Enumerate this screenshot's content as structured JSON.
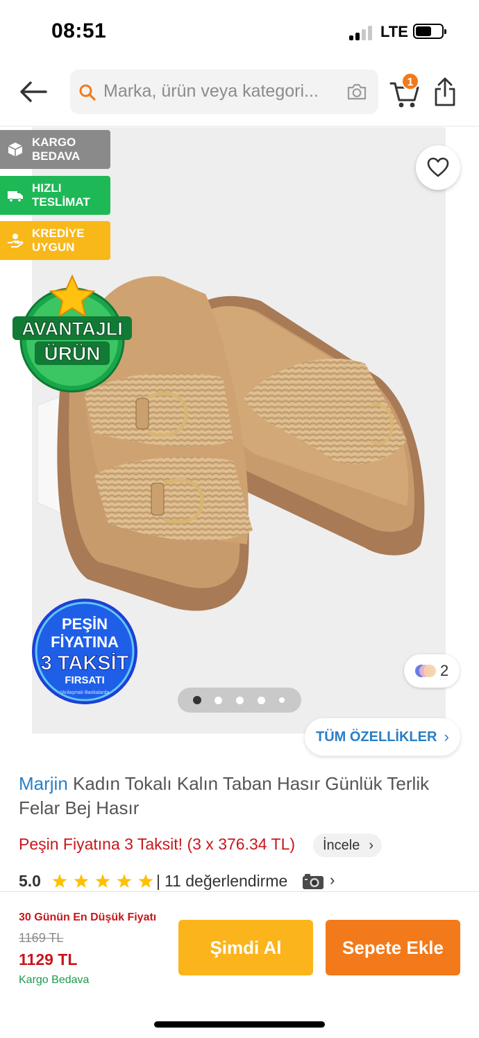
{
  "status": {
    "time": "08:51",
    "network": "LTE",
    "battery_level": 0.6
  },
  "header": {
    "search_placeholder": "Marka, ürün veya kategori...",
    "cart_count": "1"
  },
  "badges": [
    {
      "line1": "KARGO",
      "line2": "BEDAVA",
      "color": "#8a8a8a",
      "icon": "box-icon"
    },
    {
      "line1": "HIZLI",
      "line2": "TESLİMAT",
      "color": "#1fb856",
      "icon": "truck-icon"
    },
    {
      "line1": "KREDİYE",
      "line2": "UYGUN",
      "color": "#f8b819",
      "icon": "hand-coin-icon"
    }
  ],
  "gallery": {
    "avantajli_line1": "AVANTAJLI",
    "avantajli_line2": "ÜRÜN",
    "pesin_line1": "PEŞİN",
    "pesin_line2": "FİYATINA",
    "pesin_line3": "3 TAKSİT",
    "pesin_line4": "FIRSATI",
    "pesin_note": "*Anlaşmalı Bankalarda",
    "color_count": "2",
    "active_image": 1,
    "image_count": 5,
    "all_specs_label": "TÜM ÖZELLİKLER"
  },
  "product": {
    "brand": "Marjin",
    "title": " Kadın Tokalı Kalın Taban Hasır Günlük Terlik Felar Bej Hasır",
    "installment_text": "Peşin Fiyatına 3 Taksit! (3 x 376.34 TL)",
    "incele_label": "İncele",
    "rating": "5.0",
    "stars": 5,
    "rating_separator": "|",
    "review_count_text": "11 değerlendirme"
  },
  "bottom": {
    "lowest_label": "30 Günün En Düşük Fiyatı",
    "old_price": "1169 TL",
    "new_price": "1129 TL",
    "free_cargo": "Kargo Bedava",
    "buy_now": "Şimdi Al",
    "add_to_cart": "Sepete Ekle"
  },
  "colors": {
    "accent": "#f27a1a",
    "link": "#2a7ec6",
    "price_red": "#c9161b",
    "buy_yellow": "#fbb41b",
    "green": "#1a9a4b"
  }
}
